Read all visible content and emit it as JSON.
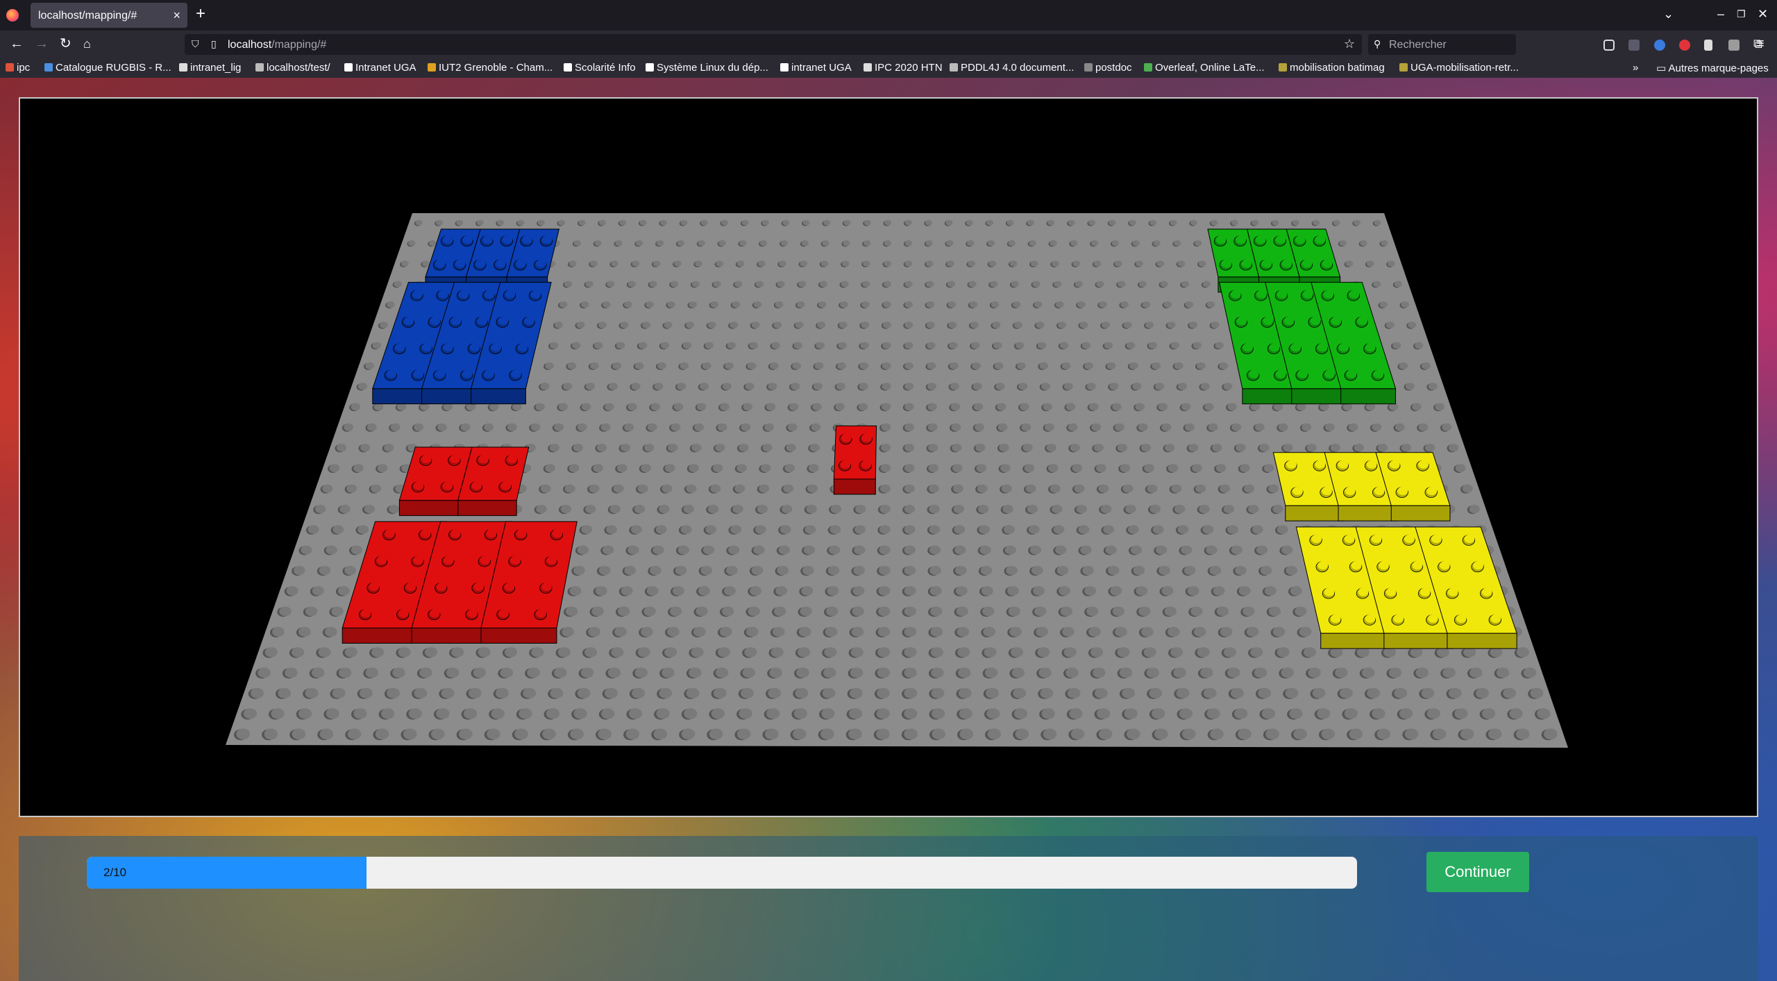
{
  "browser": {
    "tab_title": "localhost/mapping/#",
    "tab_close": "×",
    "new_tab": "+",
    "url_host": "localhost",
    "url_path": "/mapping/#",
    "search_placeholder": "Rechercher",
    "bookmarks": [
      {
        "label": "ipc",
        "color": "#e0523a"
      },
      {
        "label": "Catalogue RUGBIS - R...",
        "color": "#4a8fe0"
      },
      {
        "label": "intranet_lig",
        "color": "#dddddd"
      },
      {
        "label": "localhost/test/",
        "color": "#bbbbbb"
      },
      {
        "label": "Intranet UGA",
        "color": "#ffffff"
      },
      {
        "label": "IUT2 Grenoble - Cham...",
        "color": "#e0a020"
      },
      {
        "label": "Scolarité Info",
        "color": "#ffffff"
      },
      {
        "label": "Système Linux du dép...",
        "color": "#ffffff"
      },
      {
        "label": "intranet UGA",
        "color": "#ffffff"
      },
      {
        "label": "IPC 2020 HTN",
        "color": "#dddddd"
      },
      {
        "label": "PDDL4J 4.0 document...",
        "color": "#bbbbbb"
      },
      {
        "label": "postdoc",
        "color": "#888888"
      },
      {
        "label": "Overleaf, Online LaTe...",
        "color": "#4caf50"
      },
      {
        "label": "mobilisation batimag",
        "color": "#b5a23a"
      },
      {
        "label": "UGA-mobilisation-retr...",
        "color": "#b5a23a"
      }
    ],
    "other_bookmarks": "Autres marque-pages"
  },
  "scene": {
    "colors": {
      "baseplate": "#8c8c8c",
      "blue": "#0a3fb5",
      "green": "#11b511",
      "red": "#e00f0f",
      "yellow": "#f0e80a"
    }
  },
  "progress": {
    "label": "2/10",
    "current": 2,
    "total": 10,
    "fill_color": "#1e90ff"
  },
  "actions": {
    "continue_label": "Continuer",
    "continue_color": "#27ae60"
  }
}
